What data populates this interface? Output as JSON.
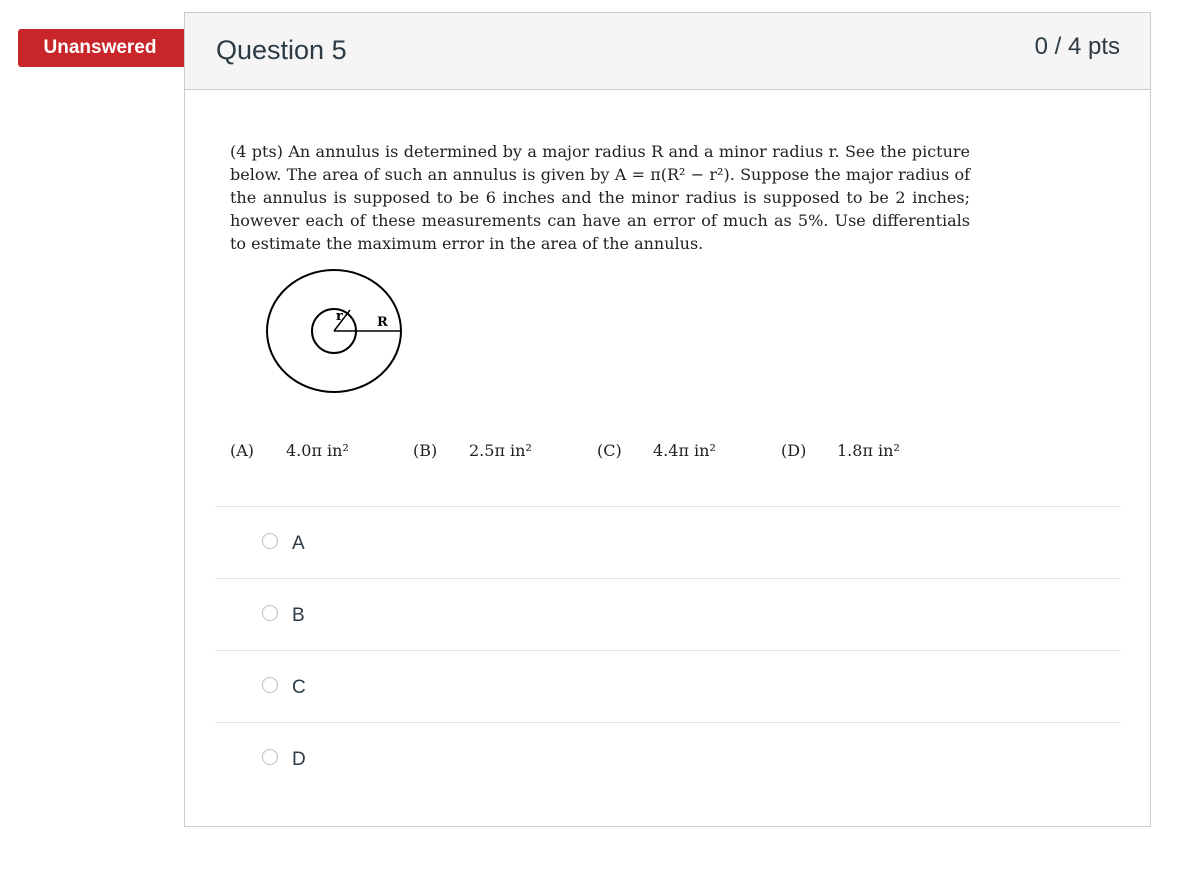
{
  "status_badge": "Unanswered",
  "question": {
    "title": "Question 5",
    "points": "0 / 4 pts",
    "text": "(4 pts) An annulus is determined by a major radius R and a minor radius r. See the picture below. The area of such an annulus is given by A = π(R² − r²). Suppose the major radius of the annulus is supposed to be 6 inches and the minor radius is supposed to be 2 inches; however each of these measurements can have an error of much as 5%. Use differentials to estimate the maximum error in the area of the annulus.",
    "figure": {
      "small_label": "r",
      "large_label": "R"
    },
    "choices": [
      {
        "label": "(A)",
        "value": "4.0π in²"
      },
      {
        "label": "(B)",
        "value": "2.5π in²"
      },
      {
        "label": "(C)",
        "value": "4.4π in²"
      },
      {
        "label": "(D)",
        "value": "1.8π in²"
      }
    ]
  },
  "answers": [
    {
      "label": "A",
      "selected": false
    },
    {
      "label": "B",
      "selected": false
    },
    {
      "label": "C",
      "selected": false
    },
    {
      "label": "D",
      "selected": false
    }
  ]
}
